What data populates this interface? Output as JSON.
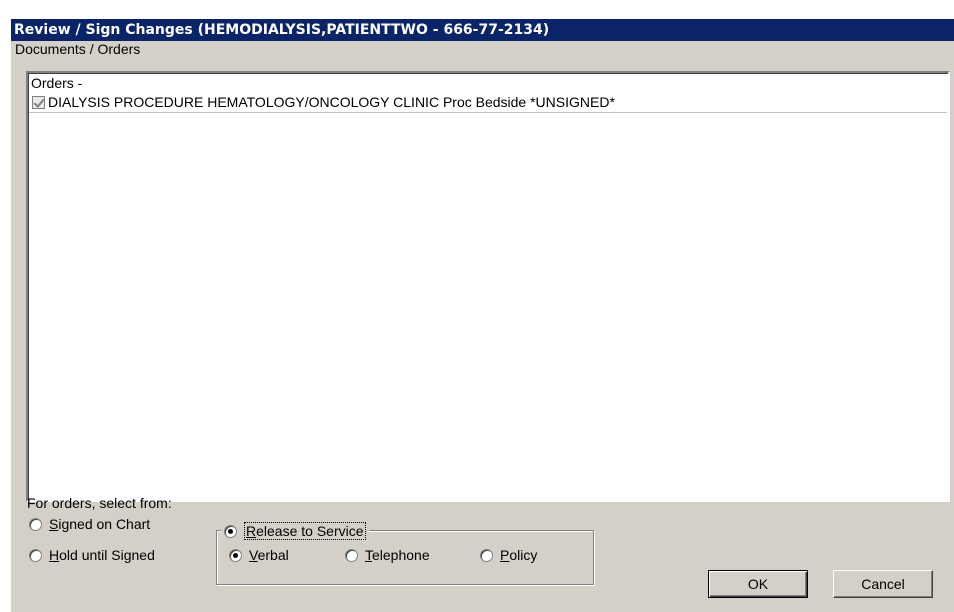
{
  "window": {
    "title": "Review / Sign Changes  (HEMODIALYSIS,PATIENTTWO - 666-77-2134)"
  },
  "documents_label": "Documents / Orders",
  "list": {
    "header": "Orders -",
    "items": [
      {
        "label": "DIALYSIS PROCEDURE HEMATOLOGY/ONCOLOGY CLINIC Proc Bedside *UNSIGNED*",
        "checked": true
      }
    ]
  },
  "options": {
    "prompt": "For orders, select from:",
    "signed_on_chart": {
      "pre": "",
      "key": "S",
      "post": "igned on Chart",
      "selected": false
    },
    "hold_until_signed": {
      "pre": "",
      "key": "H",
      "post": "old until Signed",
      "selected": false
    },
    "release_to_service": {
      "pre": "",
      "key": "R",
      "post": "elease to Service",
      "selected": true
    },
    "verbal": {
      "pre": "",
      "key": "V",
      "post": "erbal",
      "selected": true
    },
    "telephone": {
      "pre": "",
      "key": "T",
      "post": "elephone",
      "selected": false
    },
    "policy": {
      "pre": "",
      "key": "P",
      "post": "olicy",
      "selected": false
    }
  },
  "buttons": {
    "ok": "OK",
    "cancel": "Cancel"
  }
}
